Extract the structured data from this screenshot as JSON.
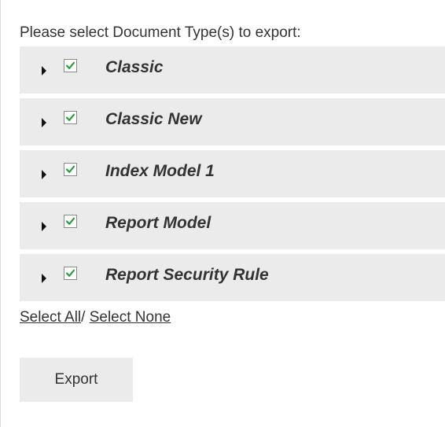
{
  "prompt": "Please select Document Type(s) to export:",
  "document_types": [
    {
      "label": "Classic",
      "checked": true
    },
    {
      "label": "Classic New",
      "checked": true
    },
    {
      "label": "Index Model 1",
      "checked": true
    },
    {
      "label": "Report Model",
      "checked": true
    },
    {
      "label": "Report Security Rule",
      "checked": true
    }
  ],
  "links": {
    "select_all": "Select All",
    "separator": "/",
    "select_none": "Select None"
  },
  "export_button": "Export",
  "colors": {
    "row_background": "#ebebeb",
    "checkmark": "#2a9d3c",
    "text": "#333333"
  },
  "icons": {
    "expander": "triangle-right-icon",
    "checkbox": "checkbox-checked-icon"
  }
}
